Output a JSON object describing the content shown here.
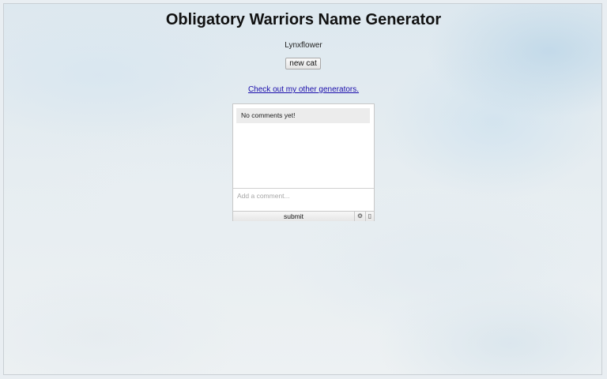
{
  "page": {
    "title": "Obligatory Warriors Name Generator",
    "generated_name": "Lynxflower",
    "new_button_label": "new cat",
    "other_generators_link": "Check out my other generators."
  },
  "comments": {
    "empty_message": "No comments yet!",
    "input_placeholder": "Add a comment...",
    "submit_label": "submit",
    "settings_icon": "⚙",
    "info_icon": "▯"
  }
}
